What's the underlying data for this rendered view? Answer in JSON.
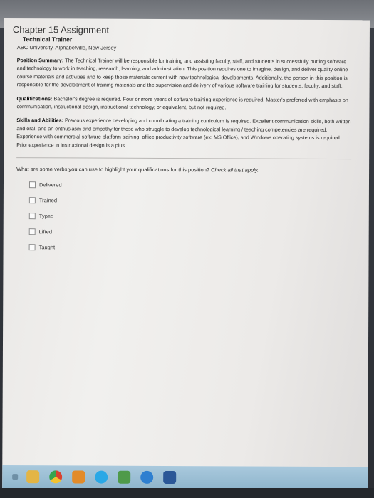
{
  "document": {
    "chapter_title": "Chapter 15 Assignment",
    "job_title": "Technical Trainer",
    "employer": "ABC University, Alphabetville, New Jersey",
    "position_summary_label": "Position Summary:",
    "position_summary_text": " The Technical Trainer will be responsible for training and assisting faculty, staff, and students in successfully putting software and technology to work in teaching, research, learning, and administration. This position requires one to imagine, design, and deliver quality online course materials and activities and to keep those materials current with new technological developments. Additionally, the person in this position is responsible for the development of training materials and the supervision and delivery of various software training for students, faculty, and staff.",
    "qualifications_label": "Qualifications:",
    "qualifications_text": " Bachelor's degree is required. Four or more years of software training experience is required. Master's preferred with emphasis on communication, instructional design, instructional technology, or equivalent, but not required.",
    "skills_label": "Skills and Abilities:",
    "skills_text": " Previous experience developing and coordinating a training curriculum is required. Excellent communication skills, both written and oral, and an enthusiasm and empathy for those who struggle to develop technological learning / teaching competencies are required. Experience with commercial software platform training, office productivity software (ex: MS Office), and Windows operating systems is required. Prior experience in instructional design is a plus."
  },
  "question": {
    "text": "What are some verbs you can use to highlight your qualifications for this position? ",
    "instruction": "Check all that apply.",
    "options": [
      {
        "label": "Delivered",
        "checked": false
      },
      {
        "label": "Trained",
        "checked": false
      },
      {
        "label": "Typed",
        "checked": false
      },
      {
        "label": "Lifted",
        "checked": false
      },
      {
        "label": "Taught",
        "checked": false
      }
    ]
  },
  "taskbar": {
    "icons": [
      "windows-start-icon",
      "file-explorer-icon",
      "chrome-icon",
      "media-player-icon",
      "skype-icon",
      "app-icon",
      "internet-explorer-icon",
      "word-icon"
    ]
  },
  "colors": {
    "screen_bg": "#efedeb",
    "taskbar_bg": "#9ec0d5",
    "text": "#222222"
  }
}
